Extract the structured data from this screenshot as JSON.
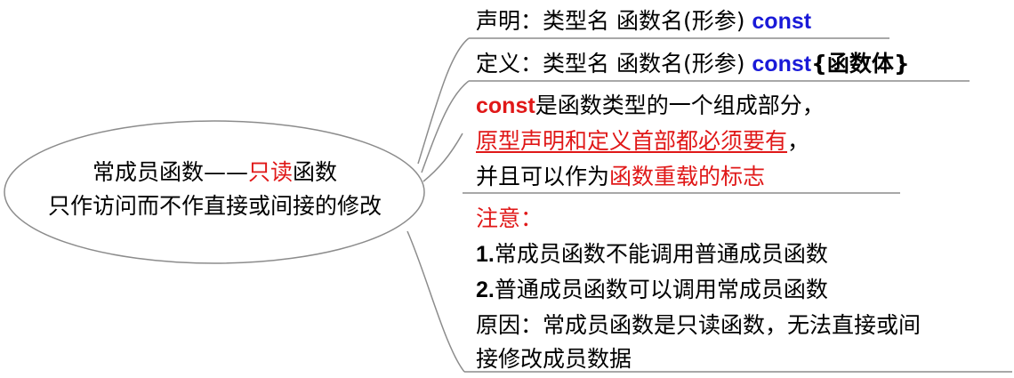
{
  "central_topic": {
    "line1_prefix": "常成员函数——",
    "line1_highlight": "只读",
    "line1_suffix": "函数",
    "line2": "只作访问而不作直接或间接的修改"
  },
  "branch_declaration": {
    "text": "声明：类型名 函数名(形参) ",
    "keyword": "const"
  },
  "branch_definition": {
    "text": "定义：类型名 函数名(形参) ",
    "keyword": "const",
    "body": "{函数体}"
  },
  "branch_const_part": {
    "keyword": "const",
    "line1_rest": "是函数类型的一个组成部分，",
    "line2_highlight": "原型声明和定义首部都必须要有",
    "line2_rest": "，",
    "line3_prefix": "并且可以作为",
    "line3_highlight": "函数重载的标志"
  },
  "branch_note": {
    "title": "注意：",
    "item1_num": "1.",
    "item1_text": "常成员函数不能调用普通成员函数",
    "item2_num": "2.",
    "item2_text": "普通成员函数可以调用常成员函数",
    "reason_line1": "原因：常成员函数是只读函数，无法直接或间",
    "reason_line2": "接修改成员数据"
  },
  "colors": {
    "keyword_blue": "#1a1ad8",
    "highlight_red": "#e01818",
    "line_gray": "#8c8c8c",
    "text": "#000000"
  }
}
